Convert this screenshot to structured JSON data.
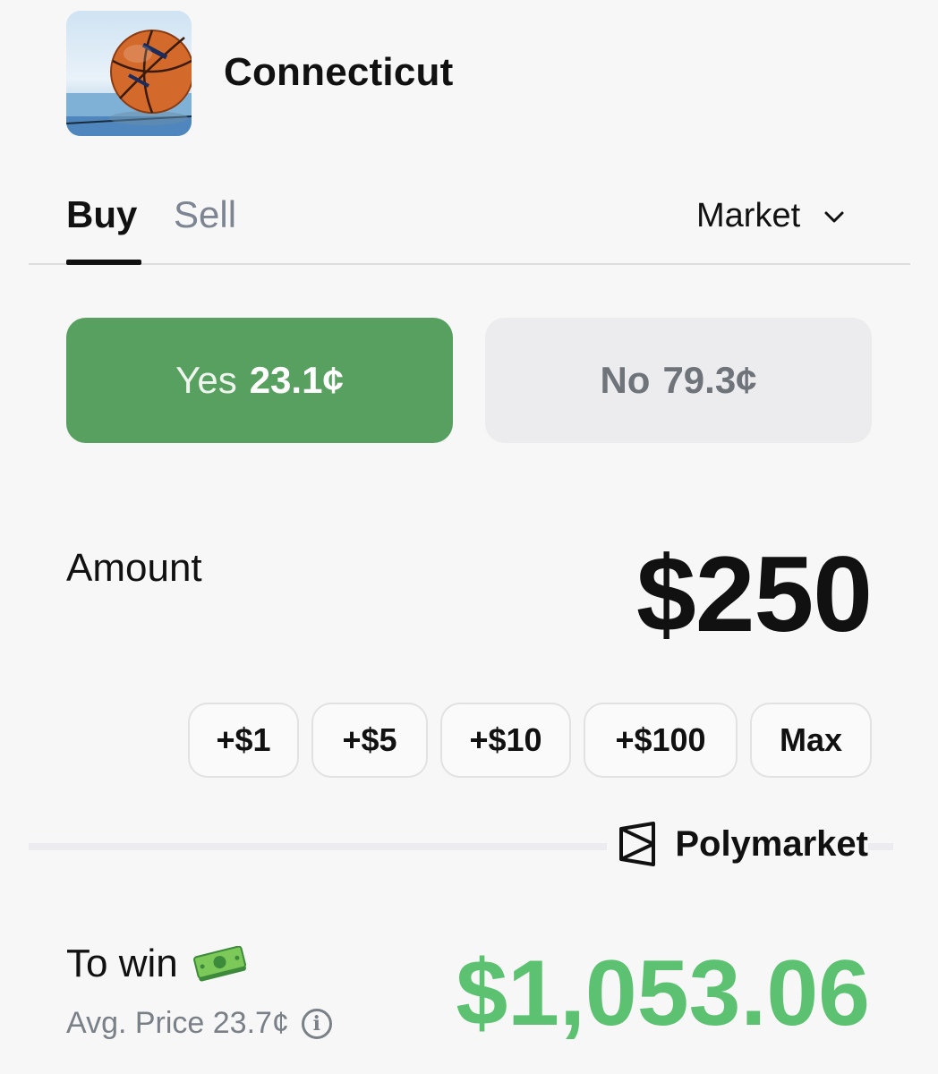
{
  "market": {
    "title": "Connecticut",
    "thumbnail_icon": "basketball-photo"
  },
  "tabs": {
    "buy_label": "Buy",
    "sell_label": "Sell",
    "active": "Buy",
    "order_type": "Market"
  },
  "outcomes": {
    "yes": {
      "label": "Yes",
      "price": "23.1¢",
      "selected": true
    },
    "no": {
      "label": "No",
      "price": "79.3¢",
      "selected": false
    }
  },
  "amount": {
    "label": "Amount",
    "value": "$250"
  },
  "quick_add": [
    "+$1",
    "+$5",
    "+$10",
    "+$100",
    "Max"
  ],
  "brand": {
    "name": "Polymarket"
  },
  "payout": {
    "label": "To win",
    "icon": "money-bill-emoji",
    "avg_price": "Avg. Price 23.7¢",
    "value": "$1,053.06"
  },
  "colors": {
    "yes_green": "#57a05f",
    "win_green": "#5cc271",
    "no_gray": "#ececee",
    "muted_text": "#7a8088"
  }
}
